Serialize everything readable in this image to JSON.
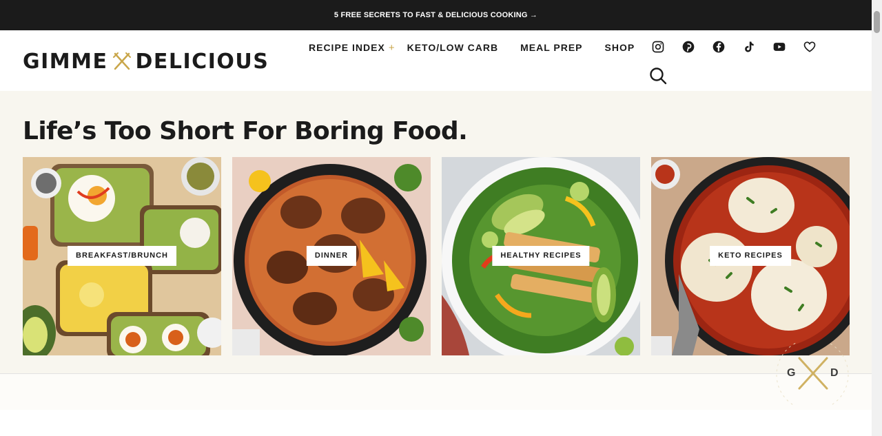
{
  "promo": {
    "text": "5 FREE SECRETS TO FAST & DELICIOUS COOKING →"
  },
  "header": {
    "logo_left": "GIMME",
    "logo_right": "DELICIOUS",
    "nav": [
      {
        "label": "RECIPE INDEX",
        "has_plus": true,
        "plus": "+"
      },
      {
        "label": "KETO/LOW CARB"
      },
      {
        "label": "MEAL PREP"
      },
      {
        "label": "SHOP"
      }
    ],
    "social_icons": [
      "instagram-icon",
      "pinterest-icon",
      "facebook-icon",
      "tiktok-icon",
      "youtube-icon",
      "heart-icon"
    ],
    "search_icon": "search-icon"
  },
  "hero": {
    "title": "Life’s Too Short For Boring Food.",
    "cards": [
      {
        "label": "BREAKFAST/BRUNCH"
      },
      {
        "label": "DINNER"
      },
      {
        "label": "HEALTHY RECIPES"
      },
      {
        "label": "KETO RECIPES"
      }
    ]
  },
  "badge": {
    "letters_left": "G",
    "letters_right": "D"
  },
  "colors": {
    "dark": "#1b1b1b",
    "gold": "#c9a64a",
    "cream": "#f8f6ef"
  }
}
